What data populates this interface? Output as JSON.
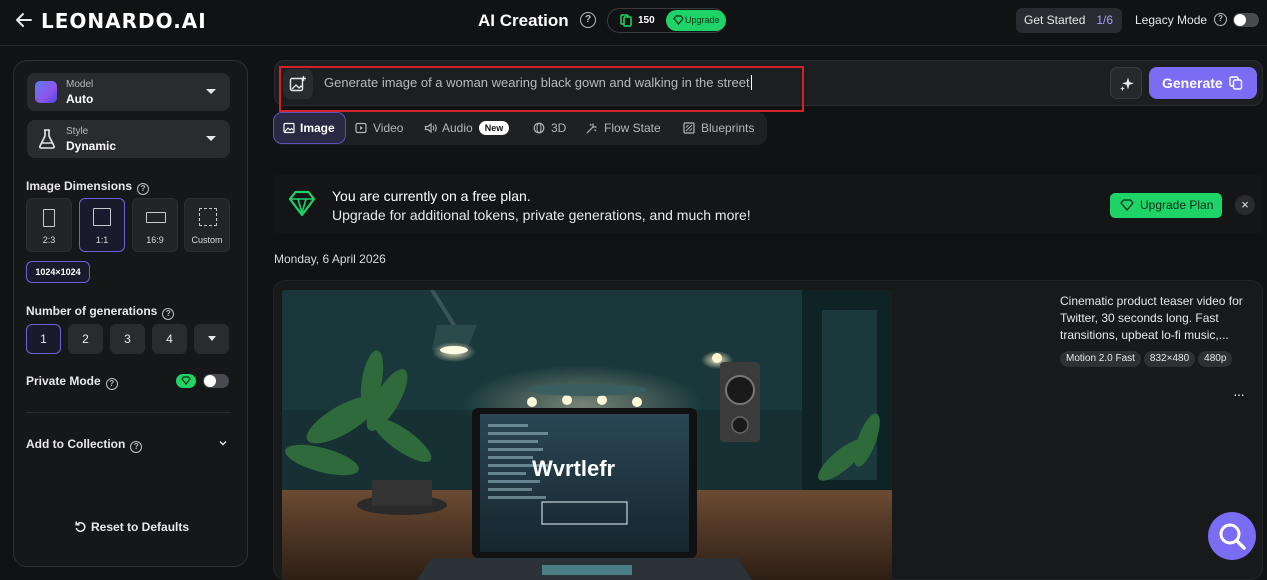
{
  "header": {
    "logo": "LEONARDO.AI",
    "page_title": "AI Creation",
    "tokens": "150",
    "upgrade_label": "Upgrade",
    "get_started_label": "Get Started",
    "get_started_progress": "1/6",
    "legacy_mode_label": "Legacy Mode",
    "legacy_mode_on": false
  },
  "sidebar": {
    "model": {
      "label": "Model",
      "value": "Auto"
    },
    "style": {
      "label": "Style",
      "value": "Dynamic"
    },
    "image_dimensions_label": "Image Dimensions",
    "dimensions": [
      {
        "label": "2:3"
      },
      {
        "label": "1:1",
        "selected": true
      },
      {
        "label": "16:9"
      },
      {
        "label": "Custom"
      }
    ],
    "size_badge": "1024×1024",
    "num_generations_label": "Number of generations",
    "generations": [
      "1",
      "2",
      "3",
      "4"
    ],
    "generations_selected": "1",
    "private_mode_label": "Private Mode",
    "private_mode_on": false,
    "add_to_collection_label": "Add to Collection",
    "reset_label": "Reset to Defaults"
  },
  "prompt": {
    "text": "Generate image of a woman wearing black gown and walking in the street",
    "generate_label": "Generate"
  },
  "tabs": [
    {
      "label": "Image",
      "active": true
    },
    {
      "label": "Video"
    },
    {
      "label": "Audio",
      "badge": "New"
    },
    {
      "label": "3D"
    },
    {
      "label": "Flow State"
    },
    {
      "label": "Blueprints"
    }
  ],
  "banner": {
    "line1": "You are currently on a free plan.",
    "line2": "Upgrade for additional tokens, private generations, and much more!",
    "button": "Upgrade Plan",
    "close": "×"
  },
  "feed": {
    "date": "Monday, 6 April 2026",
    "item": {
      "description": "Cinematic product teaser video for Twitter, 30 seconds long. Fast transitions, upbeat lo-fi music,...",
      "chips": [
        "Motion 2.0 Fast",
        "832×480",
        "480p"
      ],
      "more": "···",
      "screen_text": "Wvrtlefr"
    }
  },
  "colors": {
    "accent": "#7a6cf3",
    "green": "#1fd467",
    "highlight_box": "#d3222a",
    "background": "#111214"
  }
}
